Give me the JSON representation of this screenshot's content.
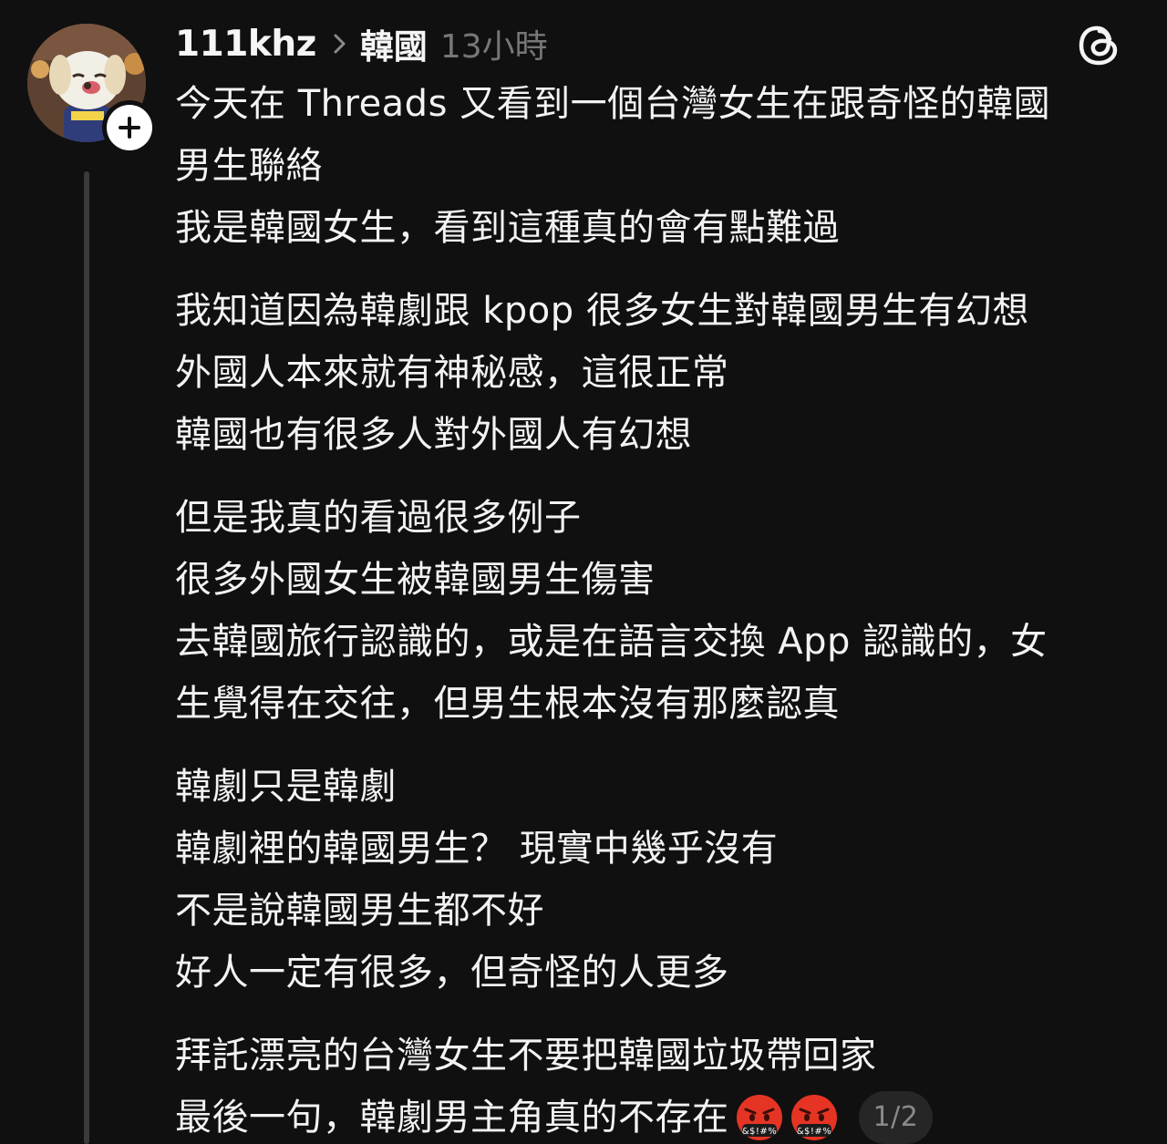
{
  "post": {
    "username": "111khz",
    "topic": "韓國",
    "timestamp": "13小時",
    "paragraphs": [
      [
        "今天在 Threads 又看到一個台灣女生在跟奇怪的韓國",
        "男生聯絡",
        "我是韓國女生，看到這種真的會有點難過"
      ],
      [
        "我知道因為韓劇跟 kpop 很多女生對韓國男生有幻想",
        "外國人本來就有神秘感，這很正常",
        "韓國也有很多人對外國人有幻想"
      ],
      [
        "但是我真的看過很多例子",
        "很多外國女生被韓國男生傷害",
        "去韓國旅行認識的，或是在語言交換 App 認識的，女",
        "生覺得在交往，但男生根本沒有那麼認真"
      ],
      [
        "韓劇只是韓劇",
        "韓劇裡的韓國男生？ 現實中幾乎沒有",
        "不是說韓國男生都不好",
        "好人一定有很多，但奇怪的人更多"
      ],
      [
        "拜託漂亮的台灣女生不要把韓國垃圾帶回家"
      ]
    ],
    "last_line": "最後一句，韓劇男主角真的不存在",
    "emoji_icons": [
      "face-with-symbols-on-mouth-icon",
      "face-with-symbols-on-mouth-icon"
    ],
    "emoji_text": "&$!#%",
    "page_indicator": "1/2"
  },
  "icons": {
    "avatar": "dog-villager-avatar",
    "follow": "plus-icon",
    "chevron": "chevron-right-icon",
    "logo": "threads-logo-icon"
  },
  "colors": {
    "background": "#101010",
    "text": "#f3f3f3",
    "muted": "#777777",
    "thread_line": "#3a3a3a",
    "badge_bg": "#262626",
    "emoji_red": "#e53424"
  }
}
